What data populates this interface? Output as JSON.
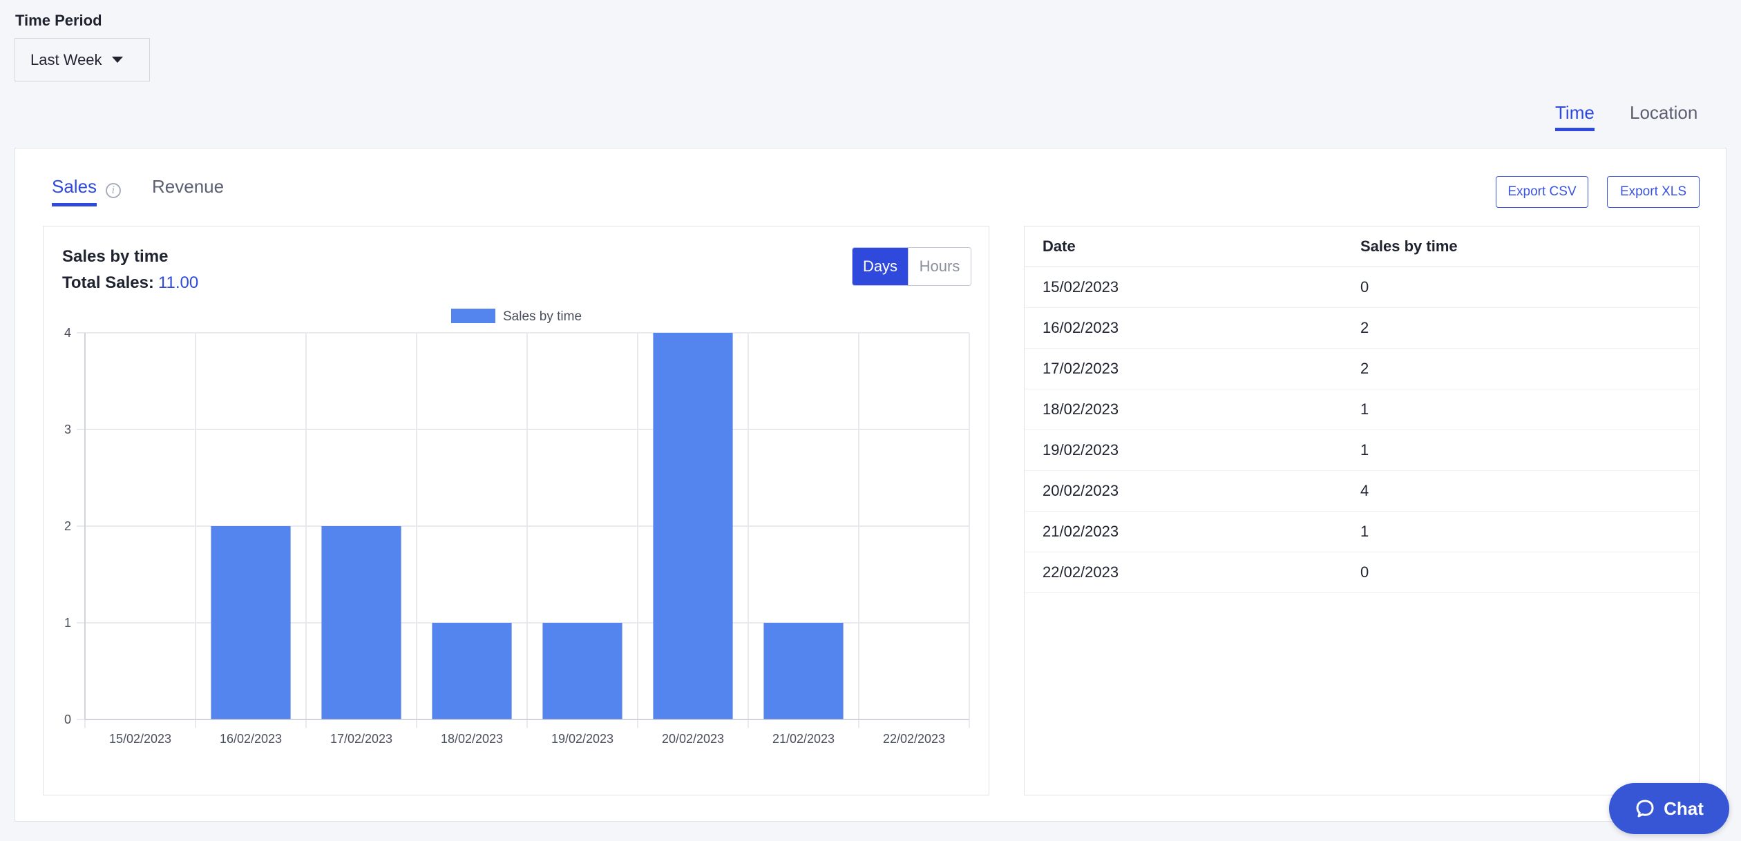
{
  "filters": {
    "time_period_label": "Time Period",
    "time_period_value": "Last Week"
  },
  "view_tabs": {
    "time": "Time",
    "location": "Location",
    "active": "time"
  },
  "metric_tabs": {
    "sales": "Sales",
    "revenue": "Revenue",
    "active": "sales"
  },
  "exports": {
    "csv": "Export CSV",
    "xls": "Export XLS"
  },
  "chart": {
    "title": "Sales by time",
    "total_label": "Total Sales:",
    "total_value": "11.00",
    "toggle": {
      "days": "Days",
      "hours": "Hours",
      "active": "days"
    }
  },
  "chart_data": {
    "type": "bar",
    "title": "Sales by time",
    "categories": [
      "15/02/2023",
      "16/02/2023",
      "17/02/2023",
      "18/02/2023",
      "19/02/2023",
      "20/02/2023",
      "21/02/2023",
      "22/02/2023"
    ],
    "series": [
      {
        "name": "Sales by time",
        "values": [
          0,
          2,
          2,
          1,
          1,
          4,
          1,
          0
        ]
      }
    ],
    "ylim": [
      0,
      4
    ],
    "yticks": [
      0,
      1,
      2,
      3,
      4
    ],
    "grid": true,
    "legend": "top",
    "bar_color": "#5484ed"
  },
  "table": {
    "headers": [
      "Date",
      "Sales by time"
    ],
    "rows": [
      [
        "15/02/2023",
        "0"
      ],
      [
        "16/02/2023",
        "2"
      ],
      [
        "17/02/2023",
        "2"
      ],
      [
        "18/02/2023",
        "1"
      ],
      [
        "19/02/2023",
        "1"
      ],
      [
        "20/02/2023",
        "4"
      ],
      [
        "21/02/2023",
        "1"
      ],
      [
        "22/02/2023",
        "0"
      ]
    ]
  },
  "chat": {
    "label": "Chat"
  },
  "colors": {
    "accent": "#2f49dd",
    "bar": "#5484ed",
    "chat": "#3656d6"
  }
}
